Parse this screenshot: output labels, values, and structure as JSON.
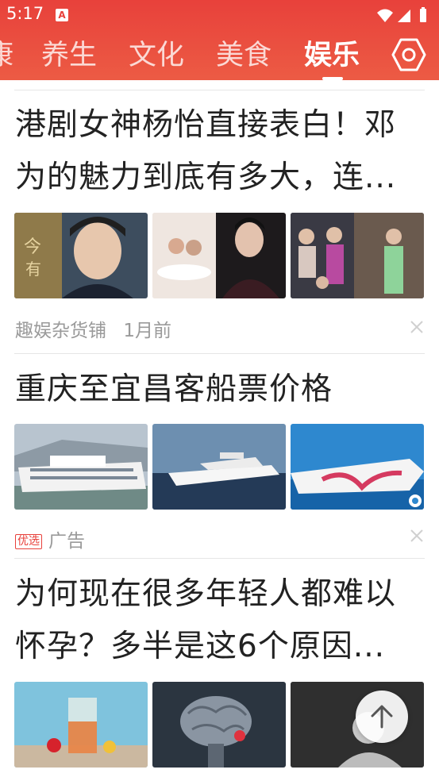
{
  "status": {
    "time": "5:17",
    "app_icon_letter": "A"
  },
  "colors": {
    "brand": "#e8413b",
    "title": "#222222",
    "meta": "#9a9a9a"
  },
  "tabs": [
    {
      "label": "康",
      "active": false
    },
    {
      "label": "养生",
      "active": false
    },
    {
      "label": "文化",
      "active": false
    },
    {
      "label": "美食",
      "active": false
    },
    {
      "label": "娱乐",
      "active": true
    }
  ],
  "feed": [
    {
      "title_line1": "港剧女神杨怡直接表白！邓",
      "title_line2": "为的魅力到底有多大，连...",
      "source": "趣娱杂货铺",
      "time": "1月前"
    },
    {
      "title_line1": "重庆至宜昌客船票价格",
      "ad_badge": "优选",
      "ad_label": "广告"
    },
    {
      "title_line1": "为何现在很多年轻人都难以",
      "title_line2": "怀孕？多半是这6个原因..."
    }
  ],
  "icons": [
    "settings-icon",
    "close-icon",
    "back-to-top-icon",
    "wifi-icon",
    "signal-icon",
    "battery-icon"
  ]
}
